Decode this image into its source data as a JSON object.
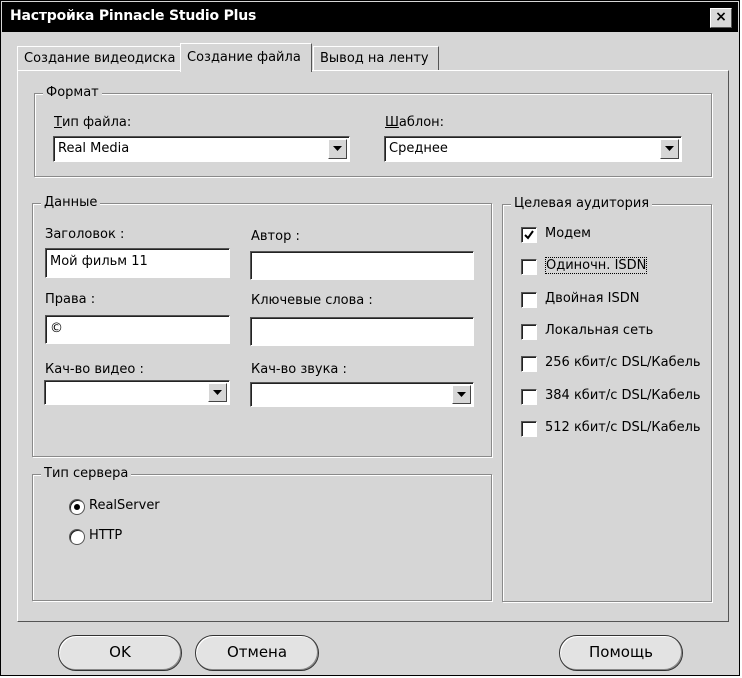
{
  "window": {
    "title": "Настройка Pinnacle Studio Plus",
    "close_label": "×"
  },
  "tabs": [
    {
      "label": "Создание видеодиска",
      "active": false
    },
    {
      "label": "Создание файла",
      "active": true
    },
    {
      "label": "Вывод на ленту",
      "active": false
    }
  ],
  "format": {
    "legend": "Формат",
    "file_type_label": "Тип файла:",
    "file_type_value": "Real Media",
    "template_label": "Шаблон:",
    "template_value": "Среднее"
  },
  "data_group": {
    "legend": "Данные",
    "title_label": "Заголовок :",
    "title_value": "Мой фильм 11",
    "author_label": "Автор :",
    "author_value": "",
    "rights_label": "Права :",
    "rights_value": "©",
    "keywords_label": "Ключевые слова :",
    "keywords_value": "",
    "video_quality_label": "Кач-во видео :",
    "video_quality_value": "",
    "audio_quality_label": "Кач-во звука :",
    "audio_quality_value": ""
  },
  "server": {
    "legend": "Тип сервера",
    "options": [
      {
        "label": "RealServer",
        "selected": true
      },
      {
        "label": "HTTP",
        "selected": false
      }
    ]
  },
  "audience": {
    "legend": "Целевая аудитория",
    "options": [
      {
        "label": "Модем",
        "checked": true
      },
      {
        "label": "Одиночн. ISDN",
        "checked": false
      },
      {
        "label": "Двойная ISDN",
        "checked": false
      },
      {
        "label": "Локальная сеть",
        "checked": false
      },
      {
        "label": "256 кбит/с DSL/Кабель",
        "checked": false
      },
      {
        "label": "384 кбит/с DSL/Кабель",
        "checked": false
      },
      {
        "label": "512 кбит/с DSL/Кабель",
        "checked": false
      }
    ]
  },
  "buttons": {
    "ok": "OK",
    "cancel": "Отмена",
    "help": "Помощь"
  },
  "icons": {
    "close": "close-icon",
    "dropdown": "chevron-down-icon",
    "check": "checkmark-icon"
  }
}
